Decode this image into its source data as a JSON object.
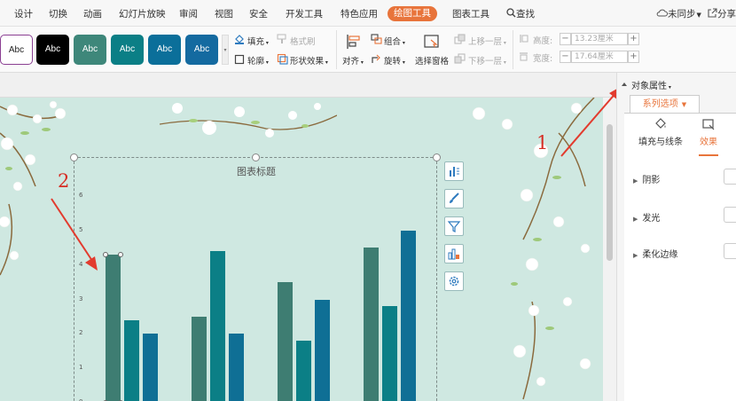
{
  "menu": {
    "items": [
      "设计",
      "切换",
      "动画",
      "幻灯片放映",
      "审阅",
      "视图",
      "安全",
      "开发工具",
      "特色应用",
      "绘图工具",
      "图表工具"
    ],
    "search": "查找",
    "sync": "未同步",
    "share": "分享"
  },
  "toolbar": {
    "styles": [
      {
        "label": "Abc",
        "bg": "#ffffff",
        "fg": "#222222"
      },
      {
        "label": "Abc",
        "bg": "#000000",
        "fg": "#ffffff"
      },
      {
        "label": "Abc",
        "bg": "#3e877a",
        "fg": "#ffffff"
      },
      {
        "label": "Abc",
        "bg": "#0b7f86",
        "fg": "#ffffff"
      },
      {
        "label": "Abc",
        "bg": "#0b6f9a",
        "fg": "#ffffff"
      },
      {
        "label": "Abc",
        "bg": "#146aa0",
        "fg": "#ffffff"
      }
    ],
    "fill": "填充",
    "format_painter": "格式刷",
    "outline": "轮廓",
    "shape_effects": "形状效果",
    "align": "对齐",
    "group": "组合",
    "rotate": "旋转",
    "selection_pane": "选择窗格",
    "bring_forward": "上移一层",
    "send_backward": "下移一层",
    "height_label": "高度:",
    "height_value": "13.23厘米",
    "width_label": "宽度:",
    "width_value": "17.64厘米",
    "minus": "−",
    "plus": "+"
  },
  "chart": {
    "title": "图表标题",
    "tools": [
      "chart-elements-icon",
      "chart-style-icon",
      "chart-filter-icon",
      "chart-layout-icon",
      "chart-settings-icon"
    ]
  },
  "chart_data": {
    "type": "bar",
    "title": "图表标题",
    "categories": [
      "",
      "",
      "",
      ""
    ],
    "series": [
      {
        "values": [
          4.3,
          2.5,
          3.5,
          4.5
        ],
        "color": "#3e7d72"
      },
      {
        "values": [
          2.4,
          4.4,
          1.8,
          2.8
        ],
        "color": "#0b7f86"
      },
      {
        "values": [
          2.0,
          2.0,
          3.0,
          5.0
        ],
        "color": "#0f6f95"
      }
    ],
    "ylim": [
      0,
      6
    ],
    "yticks": [
      0,
      1,
      2,
      3,
      4,
      5,
      6
    ],
    "grid": false
  },
  "annotations": {
    "num1": "1",
    "num2": "2"
  },
  "panel": {
    "title": "对象属性",
    "series_tab": "系列选项",
    "subtab_fill": "填充与线条",
    "subtab_effects": "效果",
    "props": [
      "阴影",
      "发光",
      "柔化边缘"
    ]
  },
  "colors": {
    "accent": "#e8743b",
    "slide_bg": "#cfe8e1",
    "annotation": "#d62d24"
  }
}
